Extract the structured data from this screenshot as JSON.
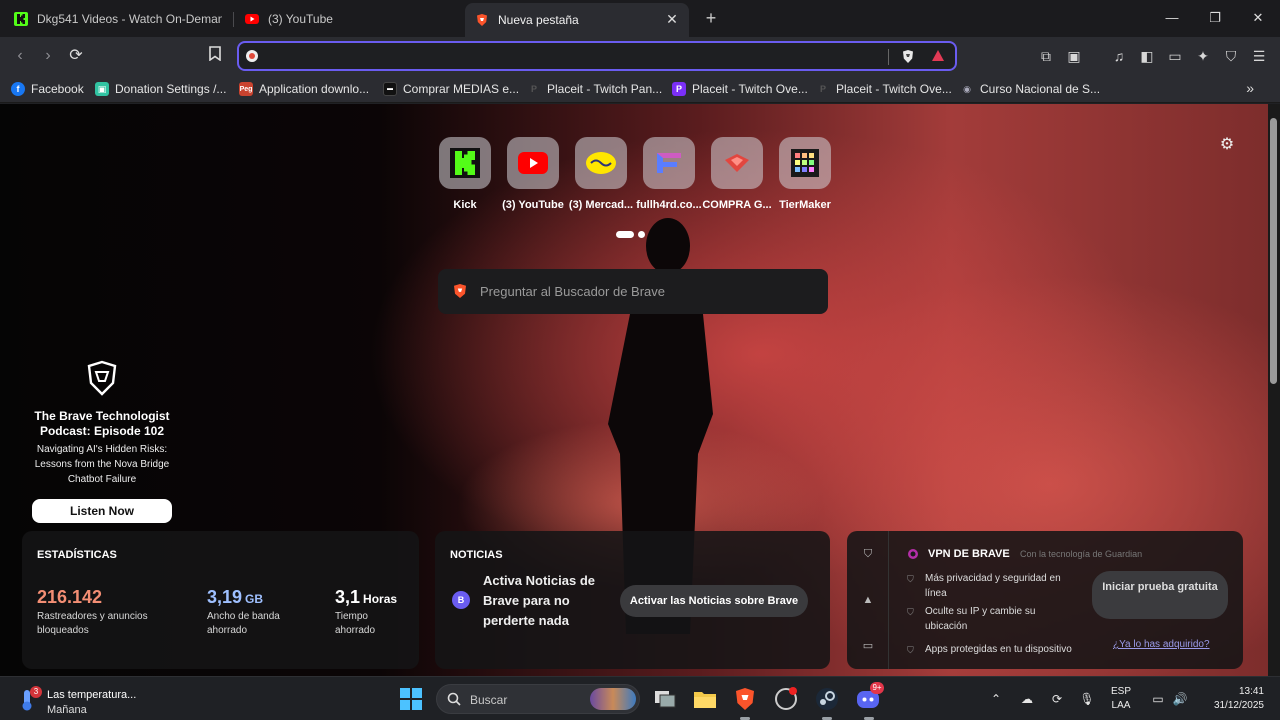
{
  "colors": {
    "accent": "#6a5cf0",
    "brave_orange": "#fb542b",
    "youtube_red": "#ff0000",
    "kick_green": "#53fc18",
    "stat_orange": "#f38e74",
    "stat_blue": "#9fc0ff"
  },
  "tabs": [
    {
      "title": "Dkg541 Videos - Watch On-Demand",
      "icon": "kick-icon"
    },
    {
      "title": "(3) YouTube",
      "icon": "youtube-icon"
    },
    {
      "title": "Nueva pestaña",
      "icon": "brave-icon",
      "active": true
    }
  ],
  "address_bar": {
    "value": "",
    "placeholder": ""
  },
  "bookmarks": [
    {
      "label": "Facebook",
      "icon": "facebook-icon"
    },
    {
      "label": "Donation Settings /...",
      "icon": "streamlabs-icon"
    },
    {
      "label": "Application downlo...",
      "icon": "peg-icon"
    },
    {
      "label": "Comprar MEDIAS e...",
      "icon": "medias-icon"
    },
    {
      "label": "Placeit - Twitch Pan...",
      "icon": "placeit-icon"
    },
    {
      "label": "Placeit - Twitch Ove...",
      "icon": "placeit-p-icon"
    },
    {
      "label": "Placeit - Twitch Ove...",
      "icon": "placeit-icon"
    },
    {
      "label": "Curso Nacional de S...",
      "icon": "curso-icon"
    }
  ],
  "top_sites": [
    {
      "label": "Kick",
      "icon": "kick-icon"
    },
    {
      "label": "(3) YouTube",
      "icon": "youtube-icon"
    },
    {
      "label": "(3) Mercad...",
      "icon": "mercadolibre-icon"
    },
    {
      "label": "fullh4rd.co...",
      "icon": "fullh4rd-icon"
    },
    {
      "label": "COMPRA G...",
      "icon": "compragamer-icon"
    },
    {
      "label": "TierMaker",
      "icon": "tiermaker-icon"
    }
  ],
  "search": {
    "placeholder": "Preguntar al Buscador de Brave"
  },
  "podcast": {
    "title": "The Brave Technologist Podcast: Episode 102",
    "description": "Navigating AI's Hidden Risks: Lessons from the Nova Bridge Chatbot Failure",
    "button": "Listen Now"
  },
  "stats": {
    "title": "ESTADÍSTICAS",
    "trackers": {
      "value": "216.142",
      "label": "Rastreadores y anuncios bloqueados"
    },
    "bandwidth": {
      "value": "3,19",
      "unit": "GB",
      "label": "Ancho de banda ahorrado"
    },
    "time": {
      "value": "3,1",
      "unit": "Horas",
      "label": "Tiempo ahorrado"
    }
  },
  "news": {
    "title": "NOTICIAS",
    "text": "Activa Noticias de Brave para no perderte nada",
    "badge": "B",
    "button": "Activar las Noticias sobre Brave"
  },
  "vpn": {
    "title": "VPN DE BRAVE",
    "powered_by": "Con la tecnología de  Guardian",
    "features": [
      "Más privacidad y seguridad en línea",
      "Oculte su IP y cambie su ubicación",
      "Apps protegidas en tu dispositivo"
    ],
    "button": "Iniciar prueba gratuita",
    "link": "¿Ya lo has adquirido?"
  },
  "taskbar": {
    "weather_title": "Las temperatura...",
    "weather_sub": "Mañana",
    "weather_badge": "3",
    "search_placeholder": "Buscar",
    "discord_badge": "9+",
    "lang_line1": "ESP",
    "lang_line2": "LAA",
    "time": "13:41",
    "date": "31/12/2025"
  }
}
